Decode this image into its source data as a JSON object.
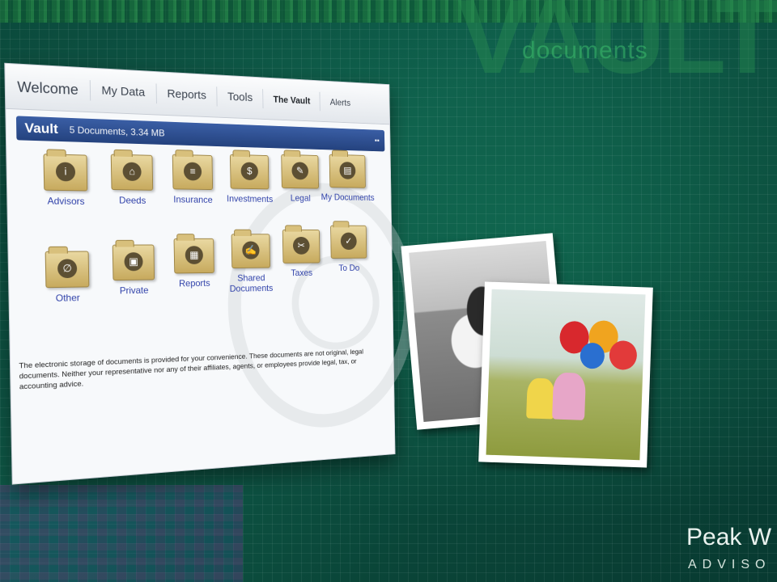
{
  "background": {
    "brand_watermark": "VAULT",
    "brand_subtitle": "documents",
    "accent_color": "#0e5a48"
  },
  "window": {
    "tabs": [
      {
        "label": "Welcome"
      },
      {
        "label": "My Data"
      },
      {
        "label": "Reports"
      },
      {
        "label": "Tools"
      },
      {
        "label": "The Vault"
      },
      {
        "label": "Alerts"
      }
    ],
    "vault_bar": {
      "title": "Vault",
      "summary": "5 Documents, 3.34 MB",
      "header_color": "#2c4c8e"
    },
    "folders": [
      {
        "label": "Advisors",
        "icon": "info-icon",
        "glyph": "i"
      },
      {
        "label": "Deeds",
        "icon": "house-icon",
        "glyph": "⌂"
      },
      {
        "label": "Insurance",
        "icon": "document-icon",
        "glyph": "≡"
      },
      {
        "label": "Investments",
        "icon": "dollar-icon",
        "glyph": "$"
      },
      {
        "label": "Legal",
        "icon": "pen-icon",
        "glyph": "✎"
      },
      {
        "label": "My Documents",
        "icon": "file-icon",
        "glyph": "▤"
      },
      {
        "label": "Other",
        "icon": "paperclip-icon",
        "glyph": "∅"
      },
      {
        "label": "Private",
        "icon": "lock-icon",
        "glyph": "▣"
      },
      {
        "label": "Reports",
        "icon": "report-icon",
        "glyph": "▦"
      },
      {
        "label": "Shared Documents",
        "icon": "share-icon",
        "glyph": "✍"
      },
      {
        "label": "Taxes",
        "icon": "tax-icon",
        "glyph": "✂"
      },
      {
        "label": "To Do",
        "icon": "check-icon",
        "glyph": "✓"
      }
    ],
    "disclaimer": "The electronic storage of documents is provided for your convenience. These documents are not original, legal documents. Neither your representative nor any of their affiliates, agents, or employees provide legal, tax, or accounting advice."
  },
  "logo": {
    "name": "Peak W",
    "tagline": "ADVISO"
  }
}
